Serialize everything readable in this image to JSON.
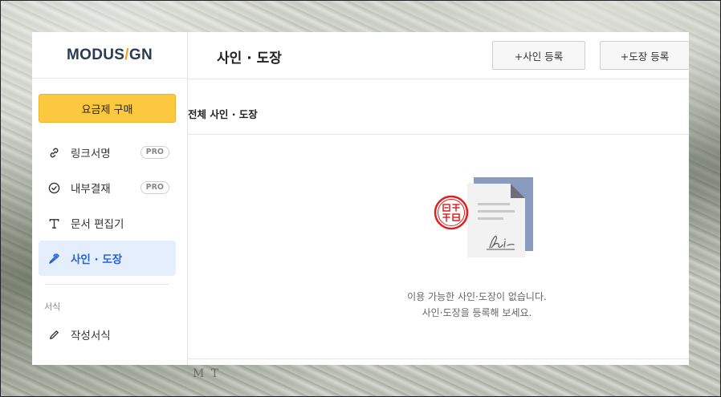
{
  "logo": {
    "part1": "MODUS",
    "slash": "/",
    "part2": "GN"
  },
  "sidebar": {
    "buy_button": "요금제 구매",
    "items": [
      {
        "label": "링크서명",
        "badge": "PRO",
        "icon": "link-icon"
      },
      {
        "label": "내부결재",
        "badge": "PRO",
        "icon": "check-circle-icon"
      },
      {
        "label": "문서 편집기",
        "icon": "text-icon"
      },
      {
        "label": "사인 · 도장",
        "icon": "pen-icon",
        "active": true
      }
    ],
    "section_label": "서식",
    "items2": [
      {
        "label": "작성서식",
        "icon": "pencil-icon"
      }
    ]
  },
  "header": {
    "title": "사인 · 도장",
    "add_sign_button": "+사인 등록",
    "add_seal_button": "+도장 등록"
  },
  "main": {
    "section_title": "전체 사인 · 도장",
    "empty_line1": "이용 가능한 사인·도장이 없습니다.",
    "empty_line2": "사인·도장을 등록해 보세요."
  },
  "colors": {
    "accent_yellow": "#fcc83f",
    "active_bg": "#e5eefc",
    "active_text": "#2a62d8",
    "stamp_red": "#e02020"
  }
}
